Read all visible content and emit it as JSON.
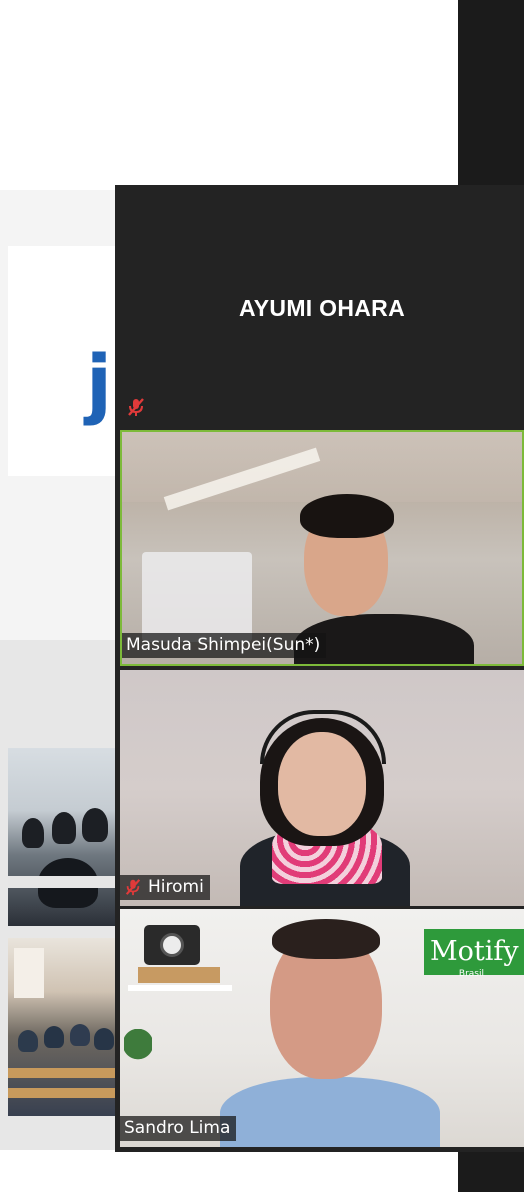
{
  "slide": {
    "logo_letter": "j"
  },
  "zoom_panel": {
    "tiles": [
      {
        "name": "AYUMI OHARA",
        "muted": true,
        "video": false
      },
      {
        "name": "Masuda Shimpei(Sun*)",
        "muted": false,
        "video": true,
        "active_speaker": true
      },
      {
        "name": "Hiromi",
        "muted": true,
        "video": true
      },
      {
        "name": "Sandro Lima",
        "muted": false,
        "video": true
      }
    ],
    "background_sign": "Motify",
    "background_sign_sub": "Brasil"
  },
  "colors": {
    "panel_bg": "#232323",
    "active_speaker_border": "#7dba3a",
    "mute_icon": "#e03a3a",
    "logo_blue": "#1f63b6"
  }
}
